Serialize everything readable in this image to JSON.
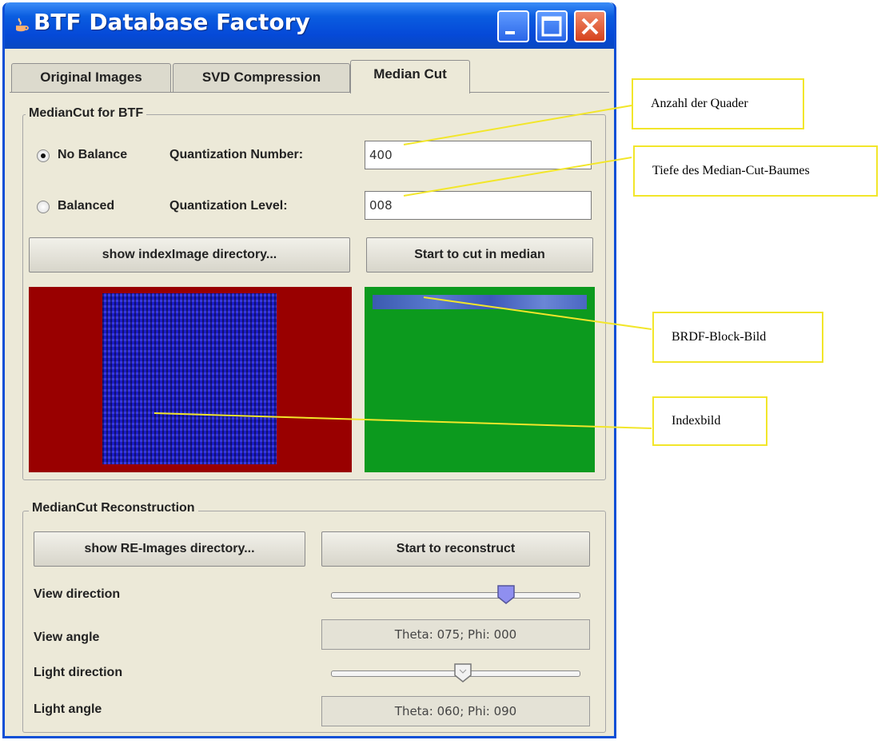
{
  "window": {
    "title": "BTF Database Factory",
    "title_icon": "java-cup-icon"
  },
  "tabs": [
    {
      "label": "Original Images",
      "active": false
    },
    {
      "label": "SVD Compression",
      "active": false
    },
    {
      "label": "Median Cut",
      "active": true
    }
  ],
  "mediancut": {
    "legend": "MedianCut for BTF",
    "radio_no_balance": {
      "label": "No Balance",
      "selected": true
    },
    "radio_balanced": {
      "label": "Balanced",
      "selected": false
    },
    "quant_number_label": "Quantization Number:",
    "quant_number_value": "400",
    "quant_level_label": "Quantization Level:",
    "quant_level_value": "008",
    "show_index_button": "show indexImage directory...",
    "start_cut_button": "Start to cut in median"
  },
  "reconstruction": {
    "legend": "MedianCut Reconstruction",
    "show_re_button": "show RE-Images directory...",
    "start_reconstruct_button": "Start to reconstruct",
    "view_direction_label": "View direction",
    "view_direction_value": 0.72,
    "view_angle_label": "View angle",
    "view_angle_value": "Theta: 075; Phi: 000",
    "light_direction_label": "Light direction",
    "light_direction_value": 0.53,
    "light_angle_label": "Light angle",
    "light_angle_value": "Theta: 060; Phi: 090"
  },
  "annotations": {
    "quader": "Anzahl der Quader",
    "tiefe": "Tiefe des Median-Cut-Baumes",
    "brdf": "BRDF-Block-Bild",
    "index": "Indexbild"
  },
  "colors": {
    "titlebar": "#0a5de0",
    "index_panel": "#990000",
    "brdf_panel": "#0c9a1e",
    "annotation_border": "#f2e62a"
  }
}
